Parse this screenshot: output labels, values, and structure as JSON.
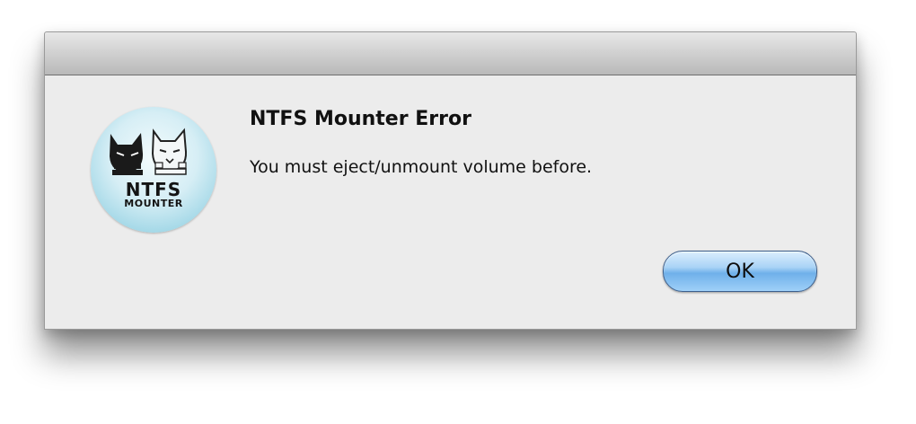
{
  "dialog": {
    "title": "NTFS Mounter Error",
    "message": "You must eject/unmount volume before.",
    "ok_label": "OK"
  },
  "app_icon": {
    "name": "ntfs-mounter-cats-icon",
    "line1": "NTFS",
    "line2": "MOUNTER"
  },
  "colors": {
    "button_accent": "#6fb0ea",
    "dialog_bg": "#ececec",
    "icon_bg": "#9fd6e6"
  }
}
